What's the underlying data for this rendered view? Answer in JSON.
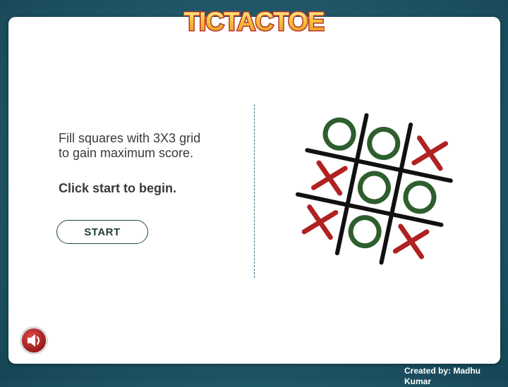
{
  "app": {
    "logo_text": "TICTACTOE"
  },
  "intro": {
    "instruction_line1": "Fill squares with 3X3 grid",
    "instruction_line2": "to gain maximum score.",
    "call_to_action": "Click start to begin.",
    "start_label": "START"
  },
  "footer": {
    "credit_line1": "Created by: Madhu",
    "credit_line2": "Kumar"
  },
  "icons": {
    "sound": "speaker-icon"
  },
  "board_illustration": {
    "marks": [
      "O",
      "O",
      "X",
      "X",
      "O",
      "O",
      "X",
      "O",
      "X"
    ]
  },
  "colors": {
    "background": "#1f5566",
    "card": "#ffffff",
    "o_mark": "#2e5e2e",
    "x_mark": "#b02222",
    "grid_line": "#111111",
    "logo_fill": "#f6c23a",
    "logo_outline": "#c0392b",
    "sound_button": "#b71c1c"
  }
}
